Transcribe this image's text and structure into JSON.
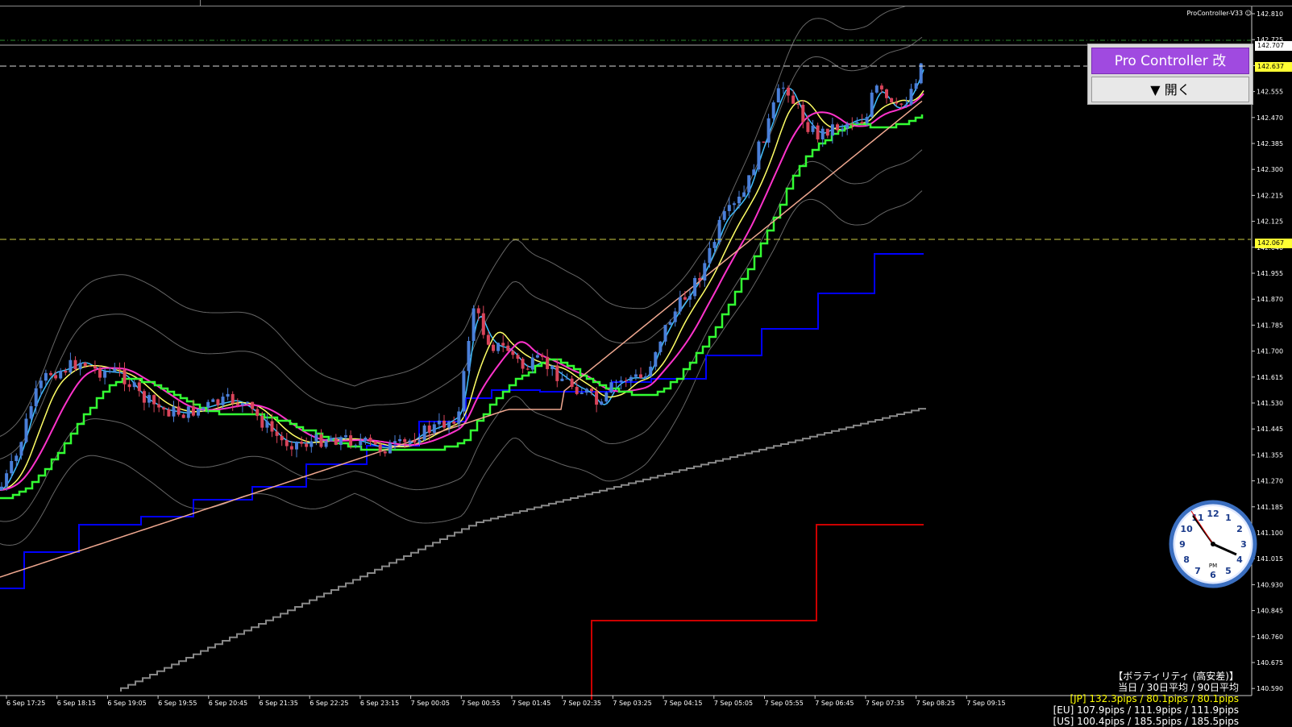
{
  "window": {
    "indicator_name": "ProController-V33",
    "smiley_icon": "smiley-icon"
  },
  "price_axis": {
    "ticks": [
      "142.810",
      "142.725",
      "142.640",
      "142.555",
      "142.470",
      "142.385",
      "142.300",
      "142.215",
      "142.125",
      "142.040",
      "141.955",
      "141.870",
      "141.785",
      "141.700",
      "141.615",
      "141.530",
      "141.445",
      "141.355",
      "141.270",
      "141.185",
      "141.100",
      "141.015",
      "140.930",
      "140.845",
      "140.760",
      "140.675",
      "140.590"
    ],
    "bid_label": "142.707",
    "ask_label": "142.637",
    "level_label": "142.067"
  },
  "time_axis": {
    "ticks": [
      "6 Sep 17:25",
      "6 Sep 18:15",
      "6 Sep 19:05",
      "6 Sep 19:55",
      "6 Sep 20:45",
      "6 Sep 21:35",
      "6 Sep 22:25",
      "6 Sep 23:15",
      "7 Sep 00:05",
      "7 Sep 00:55",
      "7 Sep 01:45",
      "7 Sep 02:35",
      "7 Sep 03:25",
      "7 Sep 04:15",
      "7 Sep 05:05",
      "7 Sep 05:55",
      "7 Sep 06:45",
      "7 Sep 07:35",
      "7 Sep 08:25",
      "7 Sep 09:15"
    ]
  },
  "pro_controller": {
    "title": "Pro Controller 改",
    "open_label": "▼ 開く"
  },
  "clock": {
    "numbers": [
      "12",
      "1",
      "2",
      "3",
      "4",
      "5",
      "6",
      "7",
      "8",
      "9",
      "10",
      "11"
    ],
    "ampm": "PM"
  },
  "volatility": {
    "title": "【ボラティリティ (高安差)】",
    "header": "当日 / 30日平均 / 90日平均",
    "jp": "[JP] 132.3pips / 80.1pips / 80.1pips",
    "eu": "[EU] 107.9pips / 111.9pips / 111.9pips",
    "us": "[US] 100.4pips / 185.5pips / 185.5pips",
    "jp_color": "#ffff00"
  },
  "colors": {
    "bull_candle": "#4a7fd9",
    "bear_candle": "#d9445a",
    "ma_fast": "#3fbfff",
    "ma_yellow": "#ffff66",
    "ma_magenta": "#ff33cc",
    "kijun_green": "#33ff33",
    "ma_salmon": "#f0a890",
    "step_blue": "#0000ff",
    "step_red": "#cc0000",
    "step_gray": "#888888",
    "bb_gray": "#666666"
  }
}
